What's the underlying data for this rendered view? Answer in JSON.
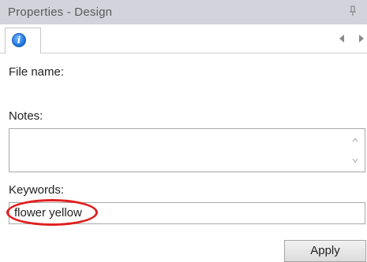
{
  "panel": {
    "title": "Properties - Design",
    "pin_icon": "pin-icon",
    "info_tab_icon": "info-icon",
    "info_tab_glyph": "i"
  },
  "fields": {
    "file_name_label": "File name:",
    "notes_label": "Notes:",
    "notes_value": "",
    "keywords_label": "Keywords:",
    "keywords_value": "flower yellow"
  },
  "actions": {
    "apply_label": "Apply"
  },
  "colors": {
    "titlebar": "#d3d3db",
    "highlight": "#e02020",
    "info_icon": "#1a6fd6"
  }
}
